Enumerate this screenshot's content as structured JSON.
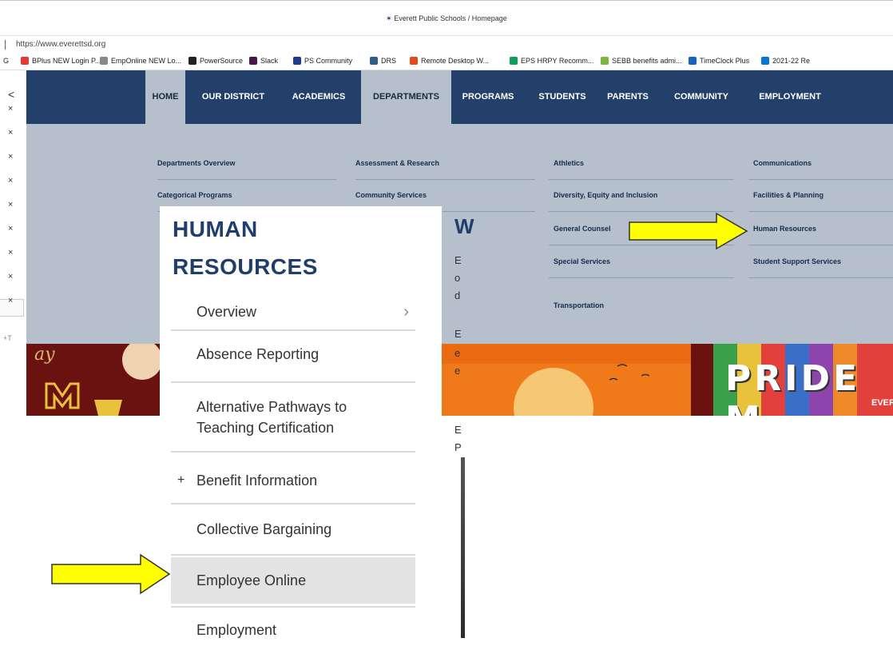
{
  "browser": {
    "window_title": "Everett Public Schools / Homepage",
    "url": "https://www.everettsd.org",
    "bookmarks": [
      {
        "label": "G",
        "color": "#555555"
      },
      {
        "label": "BPlus NEW Login P...",
        "color": "#e53935"
      },
      {
        "label": "EmpOnline NEW Lo...",
        "color": "#888888"
      },
      {
        "label": "PowerSource",
        "color": "#222222"
      },
      {
        "label": "Slack",
        "color": "#4a154b"
      },
      {
        "label": "PS Community",
        "color": "#1e3a8a"
      },
      {
        "label": "DRS",
        "color": "#2f5d8a"
      },
      {
        "label": "Remote Desktop W...",
        "color": "#e64a19"
      },
      {
        "label": "EPS HRPY Recomm...",
        "color": "#0f9d58"
      },
      {
        "label": "SEBB benefits admi...",
        "color": "#7cb342"
      },
      {
        "label": "TimeClock Plus",
        "color": "#1565c0"
      },
      {
        "label": "2021-22 Re",
        "color": "#0078d4"
      }
    ],
    "tab_close_marks": [
      "×",
      "×",
      "×",
      "×",
      "×",
      "×",
      "×",
      "×",
      "×"
    ],
    "tab_back_mark": "<",
    "tab_extra_mark": "+T"
  },
  "site": {
    "nav": [
      "HOME",
      "OUR DISTRICT",
      "ACADEMICS",
      "DEPARTMENTS",
      "PROGRAMS",
      "STUDENTS",
      "PARENTS",
      "COMMUNITY",
      "EMPLOYMENT"
    ],
    "departments_menu": {
      "col1": [
        "Departments Overview",
        "Categorical Programs"
      ],
      "col2": [
        "Assessment & Research",
        "Community Services"
      ],
      "col3": [
        "Athletics",
        "Diversity, Equity and Inclusion",
        "General Counsel",
        "Special Services",
        "Transportation"
      ],
      "col4": [
        "Communications",
        "Facilities & Planning",
        "Human Resources",
        "Student Support Services"
      ]
    },
    "banner_text": "PRIDE M",
    "banner_logo": "EVERE"
  },
  "hr_panel": {
    "title_line1": "HUMAN",
    "title_line2": "RESOURCES",
    "items": [
      {
        "label": "Overview",
        "marker": "",
        "chevron": "›"
      },
      {
        "label": "Absence Reporting",
        "marker": "",
        "chevron": ""
      },
      {
        "label": "Alternative Pathways to Teaching Certification",
        "marker": "",
        "chevron": ""
      },
      {
        "label": "Benefit Information",
        "marker": "+",
        "chevron": ""
      },
      {
        "label": "Collective Bargaining",
        "marker": "",
        "chevron": ""
      },
      {
        "label": "Employee Online",
        "marker": "",
        "chevron": ""
      },
      {
        "label": "Employment",
        "marker": "",
        "chevron": ""
      }
    ]
  },
  "background_fragments": [
    "W",
    "E",
    "o",
    "d",
    "E",
    "e",
    "e",
    "E",
    "P"
  ],
  "annotation_arrow_color": "#ffff00"
}
